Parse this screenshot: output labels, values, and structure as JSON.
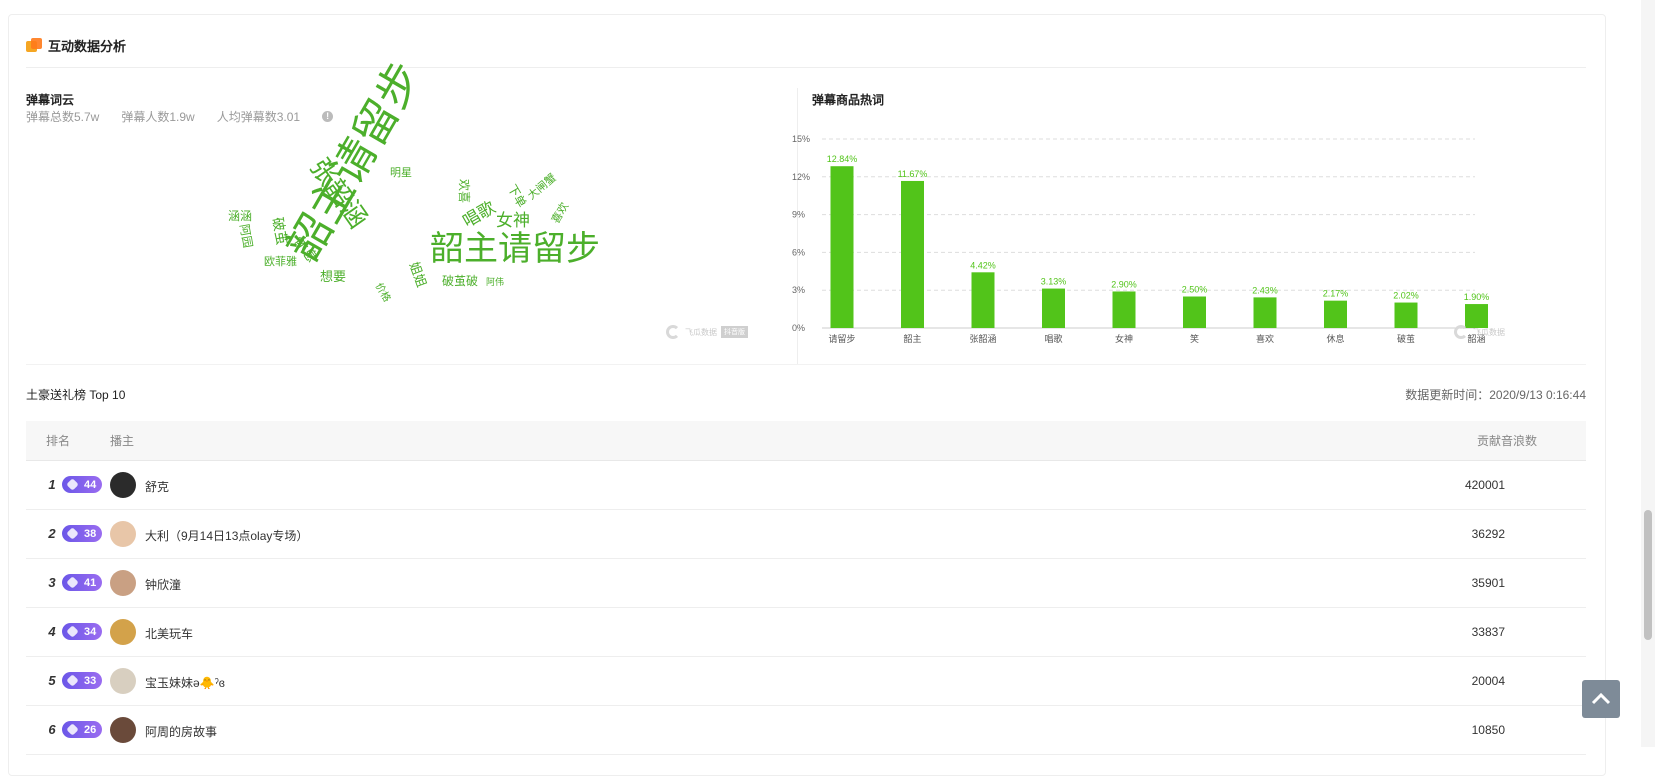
{
  "section": {
    "title": "互动数据分析"
  },
  "wordcloud": {
    "title": "弹幕词云",
    "stats": [
      "弹幕总数5.7w",
      "弹幕人数1.9w",
      "人均弹幕数3.01"
    ],
    "info_icon": "!",
    "words": [
      {
        "t": "韶主请留步",
        "size": 34
      },
      {
        "t": "韶主请留步",
        "size": 44
      },
      {
        "t": "张韶涵",
        "size": 26
      },
      {
        "t": "女神",
        "size": 17
      },
      {
        "t": "唱歌",
        "size": 17
      },
      {
        "t": "休息",
        "size": 14
      },
      {
        "t": "破茧",
        "size": 14
      },
      {
        "t": "姐姐",
        "size": 13
      },
      {
        "t": "想要",
        "size": 13
      },
      {
        "t": "破茧破",
        "size": 12
      },
      {
        "t": "欧菲雅",
        "size": 11
      },
      {
        "t": "涵涵",
        "size": 12
      },
      {
        "t": "阿园",
        "size": 12
      },
      {
        "t": "下单",
        "size": 12
      },
      {
        "t": "大闸蟹",
        "size": 11
      },
      {
        "t": "欢喜",
        "size": 12
      },
      {
        "t": "喜欢",
        "size": 11
      },
      {
        "t": "明星",
        "size": 11
      },
      {
        "t": "价格",
        "size": 10
      },
      {
        "t": "阿伟",
        "size": 9
      }
    ],
    "watermark": "飞瓜数据"
  },
  "hotwords": {
    "title": "弹幕商品热词",
    "watermark": "飞瓜数据"
  },
  "chart_data": {
    "type": "bar",
    "title": "弹幕商品热词",
    "categories": [
      "请留步",
      "韶主",
      "张韶涵",
      "唱歌",
      "女神",
      "笑",
      "喜欢",
      "休息",
      "破茧",
      "韶涵"
    ],
    "values": [
      12.84,
      11.67,
      4.42,
      3.13,
      2.9,
      2.5,
      2.43,
      2.17,
      2.02,
      1.9
    ],
    "value_labels": [
      "12.84%",
      "11.67%",
      "4.42%",
      "3.13%",
      "2.90%",
      "2.50%",
      "2.43%",
      "2.17%",
      "2.02%",
      "1.90%"
    ],
    "yticks": [
      "0%",
      "3%",
      "6%",
      "9%",
      "12%",
      "15%"
    ],
    "ylim": [
      0,
      15
    ],
    "grid": true,
    "bar_color": "#52c41a",
    "label_color": "#52c41a"
  },
  "gifts": {
    "title": "土豪送礼榜 Top 10",
    "update_time": "数据更新时间：2020/9/13 0:16:44",
    "headers": {
      "rank": "排名",
      "anchor": "播主",
      "value": "贡献音浪数"
    },
    "rows": [
      {
        "rank": "1",
        "level": "44",
        "name": "舒克",
        "value": "420001",
        "avatar_color": "#2b2b2b"
      },
      {
        "rank": "2",
        "level": "38",
        "name": "大利（9月14日13点olay专场）",
        "value": "36292",
        "avatar_color": "#e8c6a8"
      },
      {
        "rank": "3",
        "level": "41",
        "name": "钟欣潼",
        "value": "35901",
        "avatar_color": "#c9a083"
      },
      {
        "rank": "4",
        "level": "34",
        "name": "北美玩车",
        "value": "33837",
        "avatar_color": "#d3a24a"
      },
      {
        "rank": "5",
        "level": "33",
        "name": "宝玉妹妹ə🐥ˀɞ",
        "value": "20004",
        "avatar_color": "#d8cfc0"
      },
      {
        "rank": "6",
        "level": "26",
        "name": "阿周的房故事",
        "value": "10850",
        "avatar_color": "#6a4a3a"
      }
    ]
  },
  "colors": {
    "accent": "#52c41a",
    "badge": "#7b5cf0"
  }
}
